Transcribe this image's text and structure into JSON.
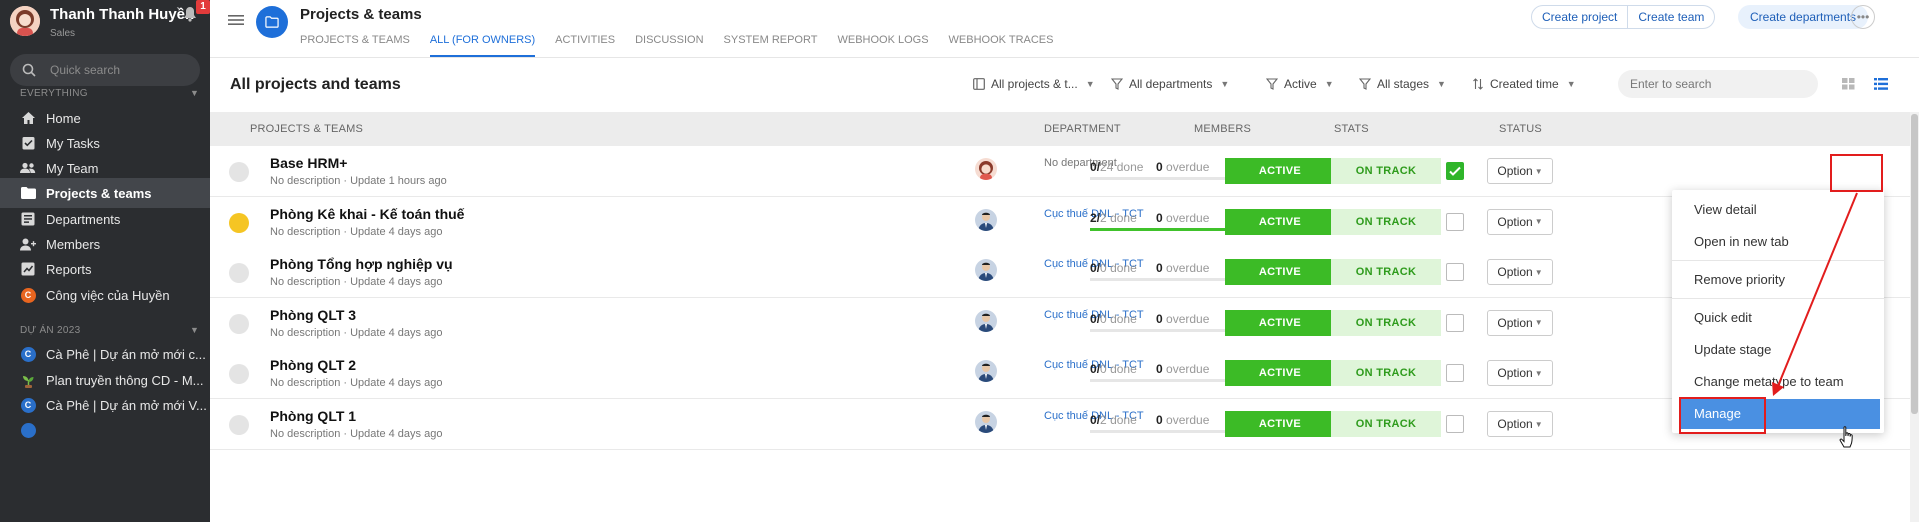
{
  "user": {
    "name": "Thanh Thanh Huyền",
    "role": "Sales",
    "notifications": "1"
  },
  "sidebar": {
    "search_placeholder": "Quick search",
    "section_everything": "EVERYTHING",
    "section_projects": "DỰ ÁN 2023",
    "items": [
      {
        "label": "Home",
        "icon": "home-icon"
      },
      {
        "label": "My Tasks",
        "icon": "tasks-icon"
      },
      {
        "label": "My Team",
        "icon": "team-icon"
      },
      {
        "label": "Projects & teams",
        "icon": "folder-icon",
        "active": true
      },
      {
        "label": "Departments",
        "icon": "departments-icon"
      },
      {
        "label": "Members",
        "icon": "members-icon"
      },
      {
        "label": "Reports",
        "icon": "reports-icon"
      },
      {
        "label": "Công việc của Huyền",
        "icon": "letter-c-icon",
        "color": "#e8651f",
        "letter": "C"
      }
    ],
    "projects": [
      {
        "label": "Cà Phê | Dự án mở mới c...",
        "color": "#2a6fc9",
        "letter": "C"
      },
      {
        "label": "Plan truyền thông CD - M...",
        "icon": "plant-icon"
      },
      {
        "label": "Cà Phê | Dự án mở mới V...",
        "color": "#2a6fc9",
        "letter": "C"
      }
    ]
  },
  "header": {
    "title": "Projects & teams",
    "tabs": [
      "PROJECTS & TEAMS",
      "ALL (FOR OWNERS)",
      "ACTIVITIES",
      "DISCUSSION",
      "SYSTEM REPORT",
      "WEBHOOK LOGS",
      "WEBHOOK TRACES"
    ],
    "active_tab": 1,
    "buttons": {
      "create_project": "Create project",
      "create_team": "Create team",
      "create_departments": "Create departments"
    }
  },
  "filters": {
    "list_title": "All projects and teams",
    "scope": "All projects & t...",
    "departments": "All departments",
    "status": "Active",
    "stages": "All stages",
    "sort": "Created time",
    "search_placeholder": "Enter to search"
  },
  "table": {
    "columns": [
      "PROJECTS & TEAMS",
      "DEPARTMENT",
      "MEMBERS",
      "STATS",
      "STATUS"
    ],
    "done_label": "done",
    "overdue_label": "overdue",
    "rows": [
      {
        "name": "Base HRM+",
        "desc": "No description · Update 1 hours ago",
        "dept": "No department",
        "done": "0",
        "total": "24",
        "overdue": "0",
        "progress": 0,
        "status": "ACTIVE",
        "stage": "ON TRACK",
        "checked": true,
        "option": "Option",
        "dot": "grey",
        "avatar": "female"
      },
      {
        "name": "Phòng Kê khai - Kế toán thuế",
        "desc": "No description · Update 4 days ago",
        "dept": "Cục thuế DNL - TCT",
        "done": "2",
        "total": "2",
        "overdue": "0",
        "progress": 1,
        "status": "ACTIVE",
        "stage": "ON TRACK",
        "checked": false,
        "option": "Option",
        "dot": "yellow",
        "avatar": "male"
      },
      {
        "name": "Phòng Tổng hợp nghiệp vụ",
        "desc": "No description · Update 4 days ago",
        "dept": "Cục thuế DNL - TCT",
        "done": "0",
        "total": "0",
        "overdue": "0",
        "progress": 0,
        "status": "ACTIVE",
        "stage": "ON TRACK",
        "checked": false,
        "option": "Option",
        "dot": "grey",
        "avatar": "male"
      },
      {
        "name": "Phòng QLT 3",
        "desc": "No description · Update 4 days ago",
        "dept": "Cục thuế DNL - TCT",
        "done": "0",
        "total": "0",
        "overdue": "0",
        "progress": 0,
        "status": "ACTIVE",
        "stage": "ON TRACK",
        "checked": false,
        "option": "Option",
        "dot": "grey",
        "avatar": "male"
      },
      {
        "name": "Phòng QLT 2",
        "desc": "No description · Update 4 days ago",
        "dept": "Cục thuế DNL - TCT",
        "done": "0",
        "total": "0",
        "overdue": "0",
        "progress": 0,
        "status": "ACTIVE",
        "stage": "ON TRACK",
        "checked": false,
        "option": "Option",
        "dot": "grey",
        "avatar": "male"
      },
      {
        "name": "Phòng QLT 1",
        "desc": "No description · Update 4 days ago",
        "dept": "Cục thuế DNL - TCT",
        "done": "0",
        "total": "2",
        "overdue": "0",
        "progress": 0,
        "status": "ACTIVE",
        "stage": "ON TRACK",
        "checked": false,
        "option": "Option",
        "dot": "grey",
        "avatar": "male"
      }
    ]
  },
  "dropdown": {
    "items": [
      "View detail",
      "Open in new tab",
      "Remove priority",
      "Quick edit",
      "Update stage",
      "Change metatype to team",
      "Manage"
    ],
    "highlighted": "Manage"
  },
  "colors": {
    "accent": "#1e6fd9",
    "active_green": "#3cbb26",
    "track_green": "#dff5d9",
    "sidebar_bg": "#2b2d30",
    "annotation_red": "#e21d1d"
  }
}
